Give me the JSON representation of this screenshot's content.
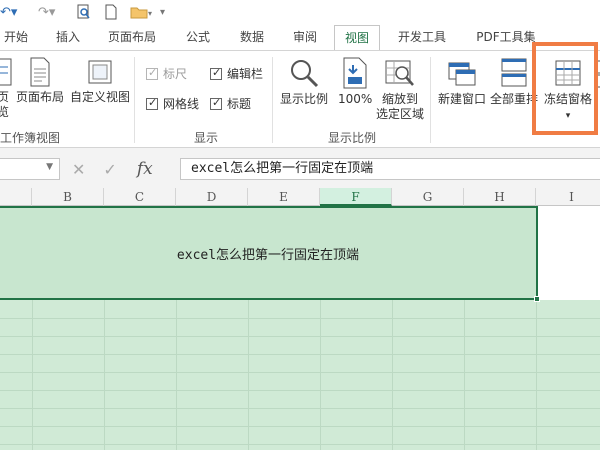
{
  "colors": {
    "accent": "#217346",
    "highlight": "#f07c44",
    "selection_fill": "#c8e6cf",
    "icon_blue": "#2e6db4"
  },
  "tabs": [
    {
      "label": "开始"
    },
    {
      "label": "插入"
    },
    {
      "label": "页面布局"
    },
    {
      "label": "公式"
    },
    {
      "label": "数据"
    },
    {
      "label": "审阅"
    },
    {
      "label": "视图",
      "active": true
    },
    {
      "label": "开发工具"
    },
    {
      "label": "PDF工具集"
    }
  ],
  "ribbon": {
    "workbook_views": {
      "group_label": "工作簿视图",
      "buttons": [
        {
          "label_top": "页",
          "label_bottom": "览"
        },
        {
          "label": "页面布局"
        },
        {
          "label": "自定义视图"
        }
      ]
    },
    "show": {
      "group_label": "显示",
      "checks": [
        {
          "label": "标尺",
          "checked": true,
          "disabled": true
        },
        {
          "label": "编辑栏",
          "checked": true
        },
        {
          "label": "网格线",
          "checked": true
        },
        {
          "label": "标题",
          "checked": true
        }
      ]
    },
    "zoom": {
      "group_label": "显示比例",
      "buttons": [
        {
          "label": "显示比例"
        },
        {
          "label": "100%"
        },
        {
          "label_top": "缩放到",
          "label_bottom": "选定区域"
        }
      ]
    },
    "window": {
      "buttons": [
        {
          "label": "新建窗口"
        },
        {
          "label": "全部重排"
        },
        {
          "label": "冻结窗格",
          "dropdown": "▾"
        }
      ]
    }
  },
  "formula_bar": {
    "cancel_icon": "✕",
    "enter_icon": "✓",
    "fx_label": "fx",
    "value": "excel怎么把第一行固定在顶端"
  },
  "columns": [
    "B",
    "C",
    "D",
    "E",
    "F",
    "G",
    "H",
    "I"
  ],
  "selected_column": "F",
  "cell_text": "excel怎么把第一行固定在顶端"
}
